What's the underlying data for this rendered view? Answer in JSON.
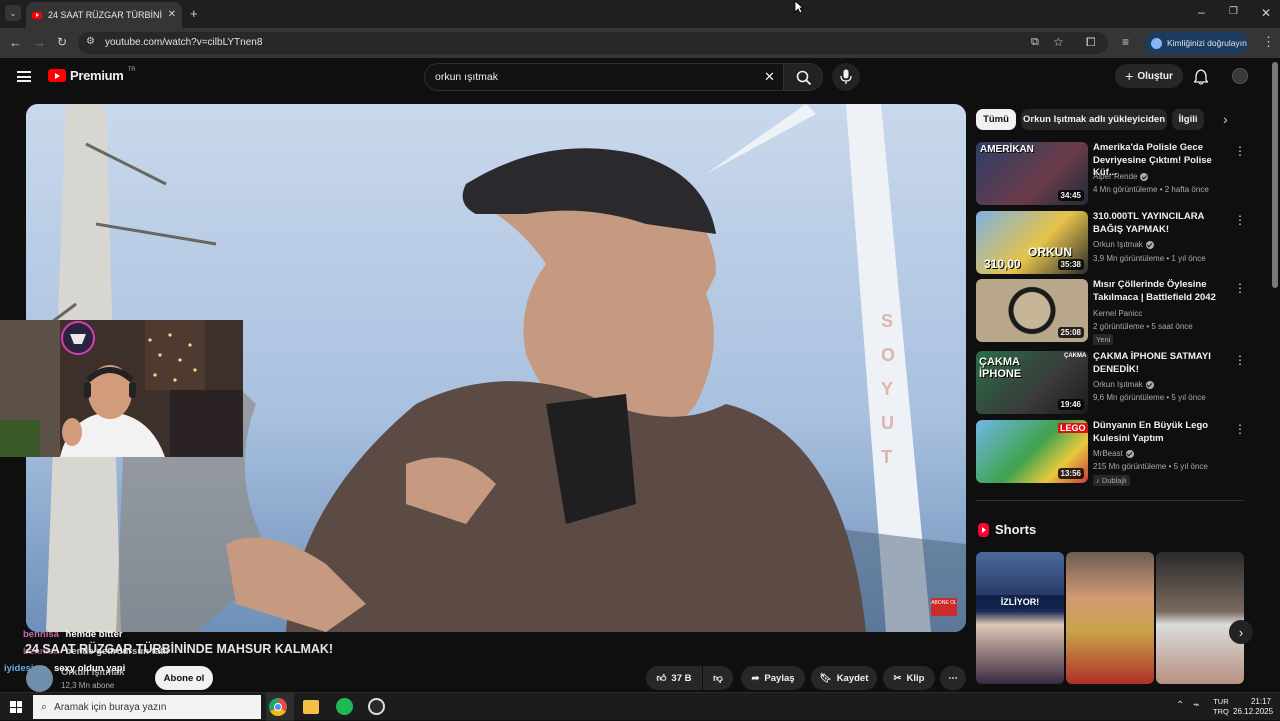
{
  "browser": {
    "tab_title": "24 SAAT RÜZGAR TÜRBİNİNDE",
    "url": "youtube.com/watch?v=cilbLYTnen8",
    "identity_button": "Kimliğinizi doğrulayın"
  },
  "header": {
    "logo_text": "Premium",
    "region": "TR",
    "search_value": "orkun ışıtmak",
    "create_label": "Oluştur"
  },
  "video": {
    "title": "24 SAAT RÜZGAR TÜRBİNİNDE MAHSUR KALMAK!",
    "channel": "Orkun Işıtmak",
    "subscribers": "12,3 Mn abone",
    "subscribe_label": "Abone ol",
    "likes": "37 B",
    "share_label": "Paylaş",
    "save_label": "Kaydet",
    "clip_label": "Klip",
    "overlay_watermark": "ABONE OL",
    "wall_letters": "SOYUT"
  },
  "chat_overlay": [
    {
      "user": "bennisa",
      "message": "hemde bitter"
    },
    {
      "user": "bennisa",
      "message": "bende getirdursun tatlı"
    },
    {
      "user": "iyidesi..m",
      "message": "sexy oldun yapi"
    }
  ],
  "sidebar": {
    "chips": [
      "Tümü",
      "Orkun Işıtmak adlı yükleyiciden",
      "İlgili"
    ],
    "recommendations": [
      {
        "title": "Amerika'da Polisle Gece Devriyesine Çıktım! Polise Küf...",
        "channel": "Alper Rende",
        "verified": true,
        "meta": "4 Mn görüntüleme • 2 hafta önce",
        "duration": "34:45",
        "badge": ""
      },
      {
        "title": "310.000TL YAYINCILARA BAĞIŞ YAPMAK!",
        "channel": "Orkun Işıtmak",
        "verified": true,
        "meta": "3,9 Mn görüntüleme • 1 yıl önce",
        "duration": "35:38",
        "badge": ""
      },
      {
        "title": "Mısır Çöllerinde Öylesine Takılmaca | Battlefield 2042",
        "channel": "Kernel Panicc",
        "verified": false,
        "meta": "2 görüntüleme • 5 saat önce",
        "duration": "25:08",
        "badge": "Yeni"
      },
      {
        "title": "ÇAKMA İPHONE SATMAYI DENEDİK!",
        "channel": "Orkun Işıtmak",
        "verified": true,
        "meta": "9,6 Mn görüntüleme • 5 yıl önce",
        "duration": "19:46",
        "badge": ""
      },
      {
        "title": "Dünyanın En Büyük Lego Kulesini Yaptım",
        "channel": "MrBeast",
        "verified": true,
        "meta": "215 Mn görüntüleme • 5 yıl önce",
        "duration": "13:56",
        "badge": "Dublajlı"
      }
    ],
    "shorts_title": "Shorts",
    "shorts_overlay_text": "İZLİYOR!"
  },
  "thumb_text": {
    "t1": "AMERİKAN",
    "t2": "ORKUN",
    "t2b": "310,00",
    "t4": "ÇAKMA İPHONE",
    "t4b": "ÇAKMA",
    "t5": "LEGO"
  },
  "taskbar": {
    "search_placeholder": "Aramak için buraya yazın",
    "lang_top": "TUR",
    "lang_bottom": "TRQ",
    "time": "21:17",
    "date": "26.12.2025"
  },
  "colors": {
    "accent_red": "#ff0000",
    "background": "#0f0f0f",
    "chip_active": "#f1f1f1"
  }
}
